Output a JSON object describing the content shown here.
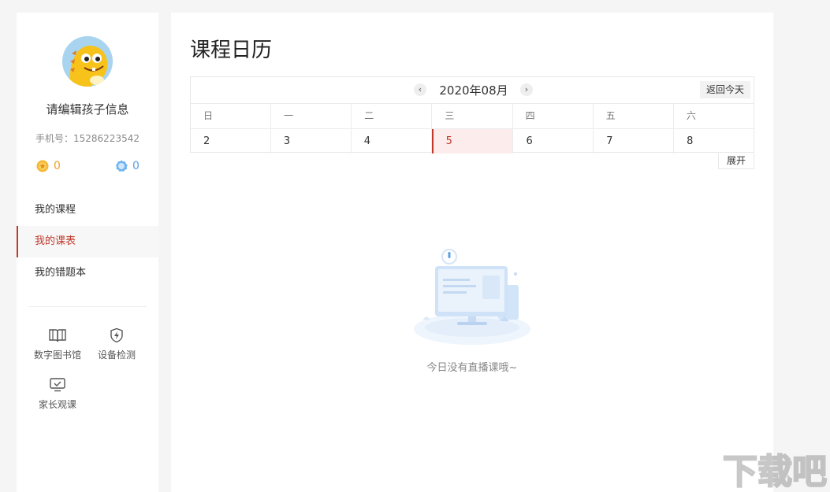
{
  "sidebar": {
    "child_name": "请编辑孩子信息",
    "phone": "手机号：15286223542",
    "gold_count": "0",
    "blue_count": "0",
    "menu": [
      {
        "label": "我的课程"
      },
      {
        "label": "我的课表"
      },
      {
        "label": "我的错题本"
      }
    ],
    "active_menu": "我的课表",
    "tools": [
      {
        "label": "数字图书馆",
        "icon": "book-icon"
      },
      {
        "label": "设备检测",
        "icon": "shield-bolt-icon"
      },
      {
        "label": "家长观课",
        "icon": "monitor-check-icon"
      }
    ]
  },
  "main": {
    "title": "课程日历",
    "calendar": {
      "month": "2020年08月",
      "today_button": "返回今天",
      "weekdays": [
        "日",
        "一",
        "二",
        "三",
        "四",
        "五",
        "六"
      ],
      "days": [
        "2",
        "3",
        "4",
        "5",
        "6",
        "7",
        "8"
      ],
      "selected_day": "5",
      "expand_button": "展开"
    },
    "empty_message": "今日没有直播课哦~"
  },
  "watermark": {
    "text": "下载吧"
  },
  "colors": {
    "accent": "#c0392b",
    "selected_bg": "#fdecec",
    "gold": "#f0a020",
    "blue": "#5aa0e6"
  }
}
